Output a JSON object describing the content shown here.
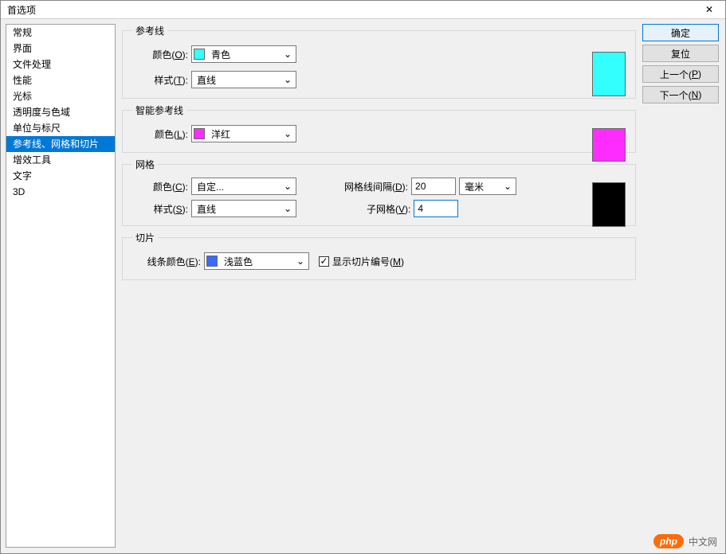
{
  "window": {
    "title": "首选项"
  },
  "sidebar": {
    "items": [
      {
        "label": "常规"
      },
      {
        "label": "界面"
      },
      {
        "label": "文件处理"
      },
      {
        "label": "性能"
      },
      {
        "label": "光标"
      },
      {
        "label": "透明度与色域"
      },
      {
        "label": "单位与标尺"
      },
      {
        "label": "参考线、网格和切片"
      },
      {
        "label": "增效工具"
      },
      {
        "label": "文字"
      },
      {
        "label": "3D"
      }
    ],
    "selected_index": 7
  },
  "groups": {
    "guides": {
      "legend": "参考线",
      "color_label_pre": "颜色(",
      "color_label_u": "O",
      "color_label_post": "):",
      "color_value": "青色",
      "style_label_pre": "样式(",
      "style_label_u": "T",
      "style_label_post": "):",
      "style_value": "直线",
      "swatch_color": "#33ffff"
    },
    "smart_guides": {
      "legend": "智能参考线",
      "color_label_pre": "颜色(",
      "color_label_u": "L",
      "color_label_post": "):",
      "color_value": "洋红",
      "swatch_color": "#ff2cff"
    },
    "grid": {
      "legend": "网格",
      "color_label_pre": "颜色(",
      "color_label_u": "C",
      "color_label_post": "):",
      "color_value": "自定...",
      "style_label_pre": "样式(",
      "style_label_u": "S",
      "style_label_post": "):",
      "style_value": "直线",
      "interval_label_pre": "网格线间隔(",
      "interval_label_u": "D",
      "interval_label_post": "):",
      "interval_value": "20",
      "interval_unit": "毫米",
      "sub_label_pre": "子网格(",
      "sub_label_u": "V",
      "sub_label_post": "):",
      "sub_value": "4",
      "swatch_color": "#000000"
    },
    "slices": {
      "legend": "切片",
      "color_label_pre": "线条颜色(",
      "color_label_u": "E",
      "color_label_post": "):",
      "color_value": "浅蓝色",
      "mini_swatch": "#3b6bff",
      "show_numbers_pre": "显示切片编号(",
      "show_numbers_u": "M",
      "show_numbers_post": ")",
      "show_numbers_checked": true
    }
  },
  "buttons": {
    "ok": "确定",
    "reset": "复位",
    "prev_pre": "上一个(",
    "prev_u": "P",
    "prev_post": ")",
    "next_pre": "下一个(",
    "next_u": "N",
    "next_post": ")"
  },
  "watermark": {
    "badge": "php",
    "text": "中文网"
  },
  "chevron": "⌄",
  "check": "✓",
  "close_x": "✕"
}
